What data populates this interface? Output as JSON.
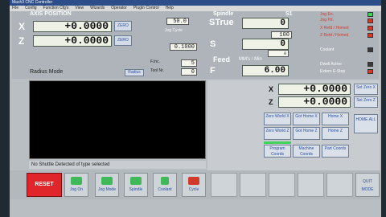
{
  "window": {
    "title": "Mach3 CNC Controller"
  },
  "menu": [
    "File",
    "Config",
    "Function Cfg's",
    "View",
    "Wizards",
    "Operator",
    "PlugIn Control",
    "Help"
  ],
  "axis_panel": {
    "title": "AXIS POSITION",
    "x_label": "X",
    "x_value": "+0.0000",
    "z_label": "Z",
    "z_value": "+0.0000",
    "zero_label": "ZERO",
    "radius_mode": "Radius Mode",
    "radius_btn": "Radius"
  },
  "feed_rate_panel": {
    "override_value": "50.0",
    "jog_label": "Jog Cycle",
    "step_value": "0.1000",
    "frac_label": "F.Inc.",
    "frac_value": "5",
    "tool_label": "Tool Nr.",
    "tool_value": "0"
  },
  "spindle_panel": {
    "title": "Spindle",
    "s1": "S1",
    "strue_label": "STrue",
    "strue_value": "0",
    "ov_value": "100",
    "s_label": "S",
    "s_value": "0",
    "feed_label": "Feed",
    "feed_units": "MM's / Min",
    "f_label": "F",
    "f_value": "6.00",
    "small_value": "0"
  },
  "status_leds": {
    "items": [
      {
        "label": "Jog En.",
        "state": "green"
      },
      {
        "label": "Jog Pd.",
        "state": "red"
      },
      {
        "label": "X Refd / Homed",
        "state": "red"
      },
      {
        "label": "Z Refd / Homed",
        "state": "red"
      },
      {
        "label": "Coolant",
        "state": "dark"
      },
      {
        "label": "Dwell Active",
        "state": "dark"
      },
      {
        "label": "Extern E-Stop",
        "state": "red"
      }
    ],
    "top_label": "Jog En.",
    "colors": {
      "green": "#3fd35a",
      "red": "#d23a2a",
      "dark": "#3a3a3a"
    }
  },
  "status_line": "No Shuttle Detected of type selected",
  "home_panel": {
    "x_label": "X",
    "x_value": "+0.0000",
    "z_label": "Z",
    "z_value": "+0.0000",
    "buttons": {
      "set_zero_x": "Set Zero X",
      "set_zero_z": "Set Zero Z",
      "zero_world_x": "Zero World X",
      "goto_home_x": "Got Home X",
      "home_x": "Home X",
      "zero_world_z": "Zero World Z",
      "goto_home_z": "Got Home Z",
      "home_z": "Home Z",
      "home_all": "HOME ALL",
      "program_coords": "Program Coords",
      "machine_coords": "Machine Coords",
      "part_coords": "Part Coords"
    }
  },
  "bottom_bar": {
    "reset": "RESET",
    "jog_on": "Jog On",
    "jog_mode": "Jog Mode",
    "spindle": "Spindle",
    "coolant": "Coolant",
    "cycle": "Cycle",
    "quit_mode": "QUIT MODE"
  }
}
